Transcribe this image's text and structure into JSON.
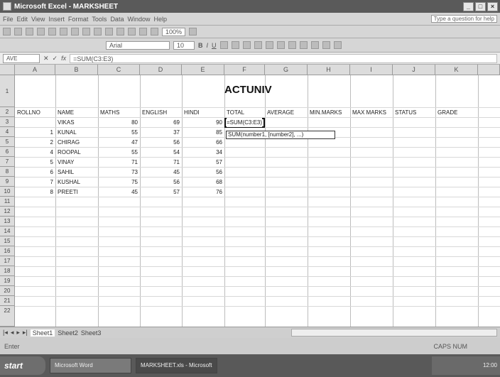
{
  "window": {
    "title": "Microsoft Excel - MARKSHEET"
  },
  "menu": {
    "items": [
      "File",
      "Edit",
      "View",
      "Insert",
      "Format",
      "Tools",
      "Data",
      "Window",
      "Help"
    ],
    "ask_placeholder": "Type a question for help"
  },
  "toolbar": {
    "zoom": "100%",
    "font": "Arial",
    "font_size": "10"
  },
  "formula_bar": {
    "cell_ref": "AVE",
    "formula": "=SUM(C3:E3)"
  },
  "sheet": {
    "columns": [
      "A",
      "B",
      "C",
      "D",
      "E",
      "F",
      "G",
      "H",
      "I",
      "J",
      "K"
    ],
    "rows": [
      "1",
      "2",
      "3",
      "4",
      "5",
      "6",
      "7",
      "8",
      "9",
      "10",
      "11",
      "12",
      "13",
      "14",
      "15",
      "16",
      "17",
      "18",
      "19",
      "20",
      "21",
      "22"
    ],
    "banner": "ACTUNIV",
    "headers": {
      "A": "ROLLNO",
      "B": "NAME",
      "C": "MATHS",
      "D": "ENGLISH",
      "E": "HINDI",
      "F": "TOTAL",
      "G": "AVERAGE",
      "H": "MIN.MARKS",
      "I": "MAX MARKS",
      "J": "STATUS",
      "K": "GRADE"
    },
    "records": [
      {
        "rollno": "",
        "name": "VIKAS",
        "maths": "80",
        "english": "69",
        "hindi": "90"
      },
      {
        "rollno": "1",
        "name": "KUNAL",
        "maths": "55",
        "english": "37",
        "hindi": "85"
      },
      {
        "rollno": "2",
        "name": "CHIRAG",
        "maths": "47",
        "english": "56",
        "hindi": "66"
      },
      {
        "rollno": "4",
        "name": "ROOPAL",
        "maths": "55",
        "english": "54",
        "hindi": "34"
      },
      {
        "rollno": "5",
        "name": "VINAY",
        "maths": "71",
        "english": "71",
        "hindi": "57"
      },
      {
        "rollno": "6",
        "name": "SAHIL",
        "maths": "73",
        "english": "45",
        "hindi": "56"
      },
      {
        "rollno": "7",
        "name": "KUSHAL",
        "maths": "75",
        "english": "56",
        "hindi": "68"
      },
      {
        "rollno": "8",
        "name": "PREETI",
        "maths": "45",
        "english": "57",
        "hindi": "76"
      }
    ],
    "editing_formula": "=SUM(C3:E3)",
    "tooltip": "SUM(number1, [number2], ...)"
  },
  "tabs": [
    "Sheet1",
    "Sheet2",
    "Sheet3"
  ],
  "status": {
    "left": "Enter",
    "right": "CAPS NUM"
  },
  "taskbar": {
    "start": "start",
    "buttons": [
      "Microsoft Word",
      "MARKSHEET.xls - Microsoft Excel"
    ],
    "clock": "12:00"
  }
}
